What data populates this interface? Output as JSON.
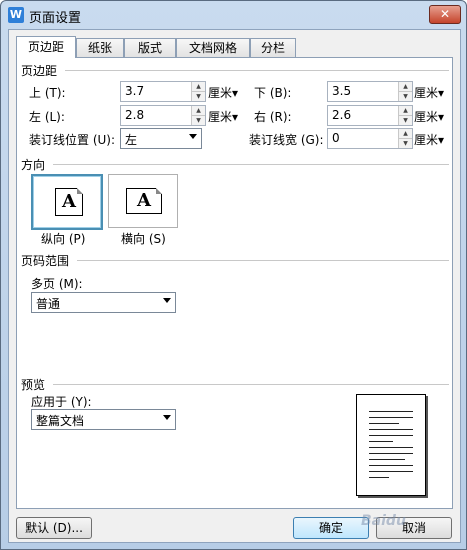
{
  "window": {
    "title": "页面设置",
    "app_icon_letter": "W",
    "close_glyph": "✕"
  },
  "tabs": [
    {
      "label": "页边距"
    },
    {
      "label": "纸张"
    },
    {
      "label": "版式"
    },
    {
      "label": "文档网格"
    },
    {
      "label": "分栏"
    }
  ],
  "margins": {
    "section_title": "页边距",
    "top": {
      "label": "上 (T):",
      "value": "3.7",
      "unit": "厘米▾"
    },
    "bottom": {
      "label": "下 (B):",
      "value": "3.5",
      "unit": "厘米▾"
    },
    "left": {
      "label": "左 (L):",
      "value": "2.8",
      "unit": "厘米▾"
    },
    "right": {
      "label": "右 (R):",
      "value": "2.6",
      "unit": "厘米▾"
    },
    "gutter_position": {
      "label": "装订线位置 (U):",
      "value": "左"
    },
    "gutter": {
      "label": "装订线宽 (G):",
      "value": "0",
      "unit": "厘米▾"
    }
  },
  "orientation": {
    "section_title": "方向",
    "portrait": {
      "label": "纵向 (P)",
      "glyph": "A"
    },
    "landscape": {
      "label": "横向 (S)",
      "glyph": "A"
    }
  },
  "pages": {
    "section_title": "页码范围",
    "multiple_label": "多页 (M):",
    "multiple_value": "普通"
  },
  "preview": {
    "section_title": "预览",
    "apply_label": "应用于 (Y):",
    "apply_value": "整篇文档"
  },
  "buttons": {
    "default": "默认 (D)...",
    "ok": "确定",
    "cancel": "取消"
  },
  "watermark": "Baidu"
}
